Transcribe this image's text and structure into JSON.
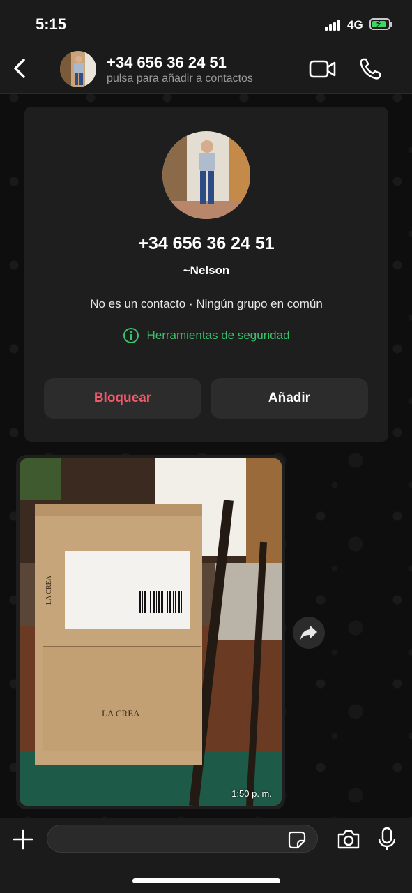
{
  "status_bar": {
    "time": "5:15",
    "network": "4G",
    "battery_level": 0.7,
    "battery_color": "#3fd463"
  },
  "header": {
    "title": "+34 656 36 24 51",
    "subtitle": "pulsa para añadir a contactos",
    "icons": [
      "back-icon",
      "video-call-icon",
      "phone-call-icon"
    ]
  },
  "contact_card": {
    "phone": "+34 656 36 24 51",
    "name": "~Nelson",
    "info": "No es un contacto · Ningún grupo en común",
    "safety_tools": "Herramientas de seguridad",
    "block_label": "Bloquear",
    "add_label": "Añadir",
    "colors": {
      "safety": "#38c26a",
      "block": "#f0596a"
    }
  },
  "message": {
    "type": "image",
    "time": "1:50 p. m.",
    "image_text": [
      "LA CREA",
      "LA CREA"
    ],
    "icons": [
      "forward-icon"
    ]
  },
  "input_bar": {
    "placeholder": "",
    "icons": [
      "plus-icon",
      "sticker-icon",
      "camera-icon",
      "mic-icon"
    ]
  }
}
